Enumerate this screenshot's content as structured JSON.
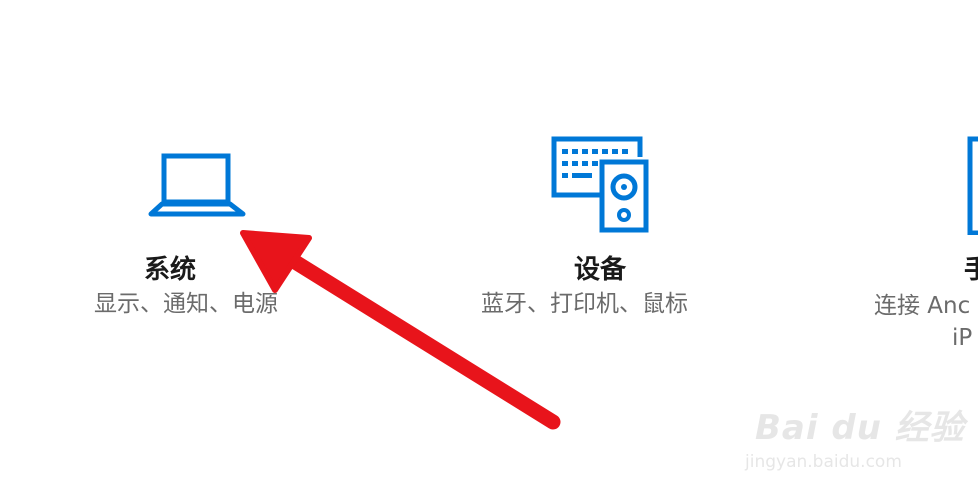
{
  "settings": {
    "tiles": [
      {
        "title": "系统",
        "description": "显示、通知、电源",
        "icon": "laptop-icon"
      },
      {
        "title": "设备",
        "description": "蓝牙、打印机、鼠标",
        "icon": "devices-icon"
      },
      {
        "title": "手",
        "description_line1": "连接 Anc",
        "description_line2": "iP",
        "icon": "phone-icon"
      }
    ]
  },
  "annotation": {
    "arrow_color": "#e8141b",
    "pointing_at": "系统"
  },
  "watermark": {
    "logo": "Bai du 经验",
    "url": "jingyan.baidu.com"
  },
  "colors": {
    "accent": "#0078d7",
    "title_text": "#1a1a1a",
    "description_text": "#6b6b6b"
  }
}
